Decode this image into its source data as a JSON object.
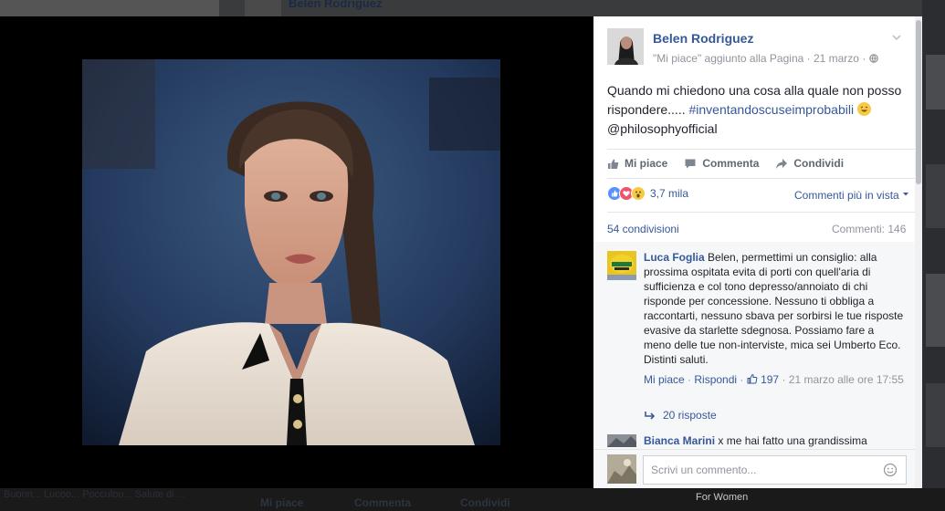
{
  "background": {
    "top_name": "Belen Rodriguez",
    "bottom_actions": [
      "Mi piace",
      "Commenta",
      "Condividi"
    ],
    "bottom_ghost": "Buonn... Lucoo... Pocculou... Salute di ...",
    "side_text": "For Women"
  },
  "post": {
    "page_name": "Belen Rodriguez",
    "subtitle": "\"Mi piace\" aggiunto alla Pagina · 21 marzo · ",
    "text_before": "Quando mi chiedono una cosa alla quale non posso rispondere..... ",
    "hashtag": "#inventandoscuseimprobabili",
    "text_after": " @philosophyofficial",
    "actions": {
      "like": "Mi piace",
      "comment": "Commenta",
      "share": "Condividi"
    },
    "reactions_count": "3,7 mila",
    "sort_label": "Commenti più in vista",
    "shares_label": "54 condivisioni",
    "comments_label": "Commenti: 146"
  },
  "comments": [
    {
      "author": "Luca Foglia",
      "text": " Belen, permettimi un consiglio: alla prossima ospitata evita di porti con quell'aria di sufficienza e col tono depresso/annoiato di chi risponde per concessione. Nessuno ti obbliga a raccontarti, nessuno sbava per sorbirsi le tue risposte evasive da starlette sdegnosa. Possiamo fare a meno delle tue non-interviste, mica sei Umberto Eco. Distinti saluti.",
      "like_label": "Mi piace",
      "reply_label": "Rispondi",
      "likes": "197",
      "time": "21 marzo alle ore 17:55",
      "replies": "20 risposte"
    },
    {
      "author": "Bianca Marini",
      "text": " x me hai fatto una grandissima"
    }
  ],
  "composer": {
    "placeholder": "Scrivi un commento..."
  },
  "colors": {
    "link": "#365899",
    "meta": "#90949c",
    "like_blue": "#5890ff"
  }
}
